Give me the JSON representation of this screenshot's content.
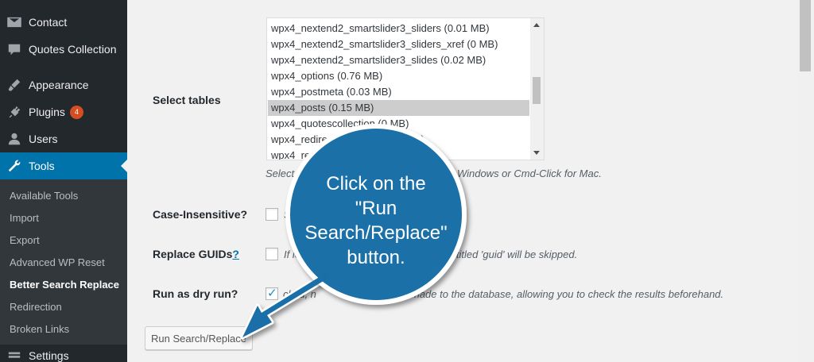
{
  "sidebar": {
    "items": [
      {
        "label": "Contact",
        "icon": "envelope-icon"
      },
      {
        "label": "Quotes Collection",
        "icon": "comment-icon"
      },
      {
        "label": "Appearance",
        "icon": "paintbrush-icon"
      },
      {
        "label": "Plugins",
        "icon": "plug-icon",
        "badge": "4"
      },
      {
        "label": "Users",
        "icon": "user-icon"
      },
      {
        "label": "Tools",
        "icon": "wrench-icon",
        "active": true
      },
      {
        "label": "Settings",
        "icon": "settings-icon"
      }
    ],
    "submenu": [
      "Available Tools",
      "Import",
      "Export",
      "Advanced WP Reset",
      "Better Search Replace",
      "Redirection",
      "Broken Links"
    ],
    "current_submenu": "Better Search Replace"
  },
  "form": {
    "select_tables": {
      "label": "Select tables",
      "options": [
        "wpx4_nextend2_smartslider3_sliders (0.01 MB)",
        "wpx4_nextend2_smartslider3_sliders_xref (0 MB)",
        "wpx4_nextend2_smartslider3_slides (0.02 MB)",
        "wpx4_options (0.76 MB)",
        "wpx4_postmeta (0.03 MB)",
        "wpx4_posts (0.15 MB)",
        "wpx4_quotescollection (0 MB)",
        "wpx4_redirectio",
        "wpx4_redi"
      ],
      "redirection_tail": "MB)",
      "selected": "wpx4_posts (0.15 MB)",
      "hint_left": "Select m",
      "hint_right": "r Windows or Cmd-Click for Mac."
    },
    "case_insensitive": {
      "label": "Case-Insensitive?",
      "desc": "Se",
      "checked": false
    },
    "replace_guids": {
      "label": "Replace GUIDs",
      "help": "?",
      "desc_left": "If le",
      "desc_right": "e titled 'guid' will be skipped.",
      "checked": false
    },
    "dry_run": {
      "label": "Run as dry run?",
      "desc_left": "cked, n",
      "desc_right": "made to the database, allowing you to check the results beforehand.",
      "checked": true
    },
    "submit_label": "Run Search/Replace"
  },
  "callout": {
    "lines": [
      "Click on the",
      "\"Run",
      "Search/Replace\"",
      "button."
    ],
    "color": "#1a6fa8"
  }
}
